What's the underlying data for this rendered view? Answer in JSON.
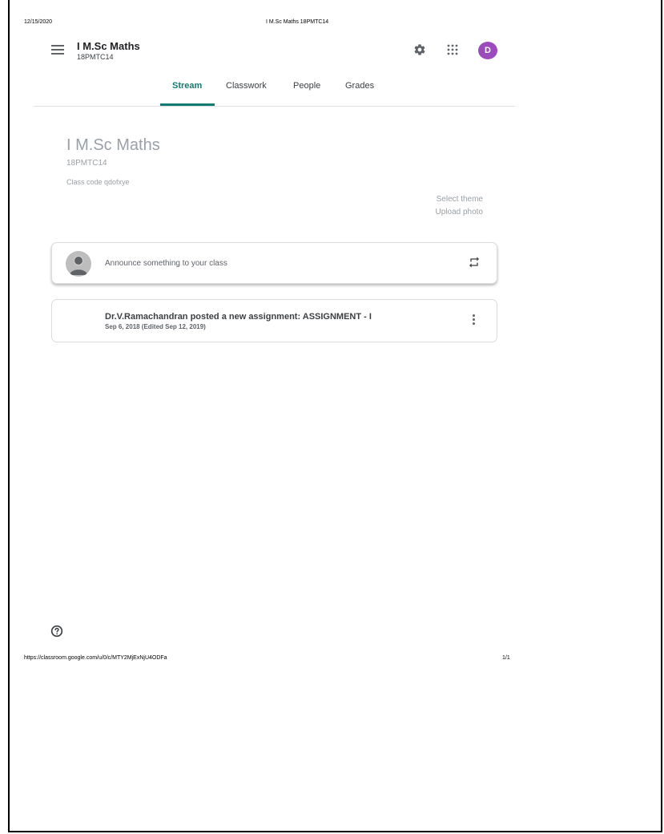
{
  "print": {
    "date": "12/15/2020",
    "title": "I M.Sc Maths 18PMTC14",
    "url": "https://classroom.google.com/u/0/c/MTY2MjExNjU4ODFa",
    "page": "1/1"
  },
  "header": {
    "class_name": "I M.Sc Maths",
    "class_section": "18PMTC14",
    "avatar_letter": "D",
    "avatar_color": "#9c4bbd",
    "icons": [
      "menu-icon",
      "gear-icon",
      "apps-icon"
    ]
  },
  "tabs": [
    {
      "label": "Stream",
      "active": true
    },
    {
      "label": "Classwork",
      "active": false
    },
    {
      "label": "People",
      "active": false
    },
    {
      "label": "Grades",
      "active": false
    }
  ],
  "accent_color": "#137a6f",
  "banner": {
    "title": "I M.Sc Maths",
    "section": "18PMTC14",
    "class_code": "Class code  qdofxye",
    "select_theme": "Select theme",
    "upload_photo": "Upload photo"
  },
  "announce": {
    "placeholder": "Announce something to your class"
  },
  "posts": [
    {
      "title": "Dr.V.Ramachandran posted a new assignment: ASSIGNMENT - I",
      "date": "Sep 6, 2018 (Edited Sep 12, 2019)"
    }
  ]
}
